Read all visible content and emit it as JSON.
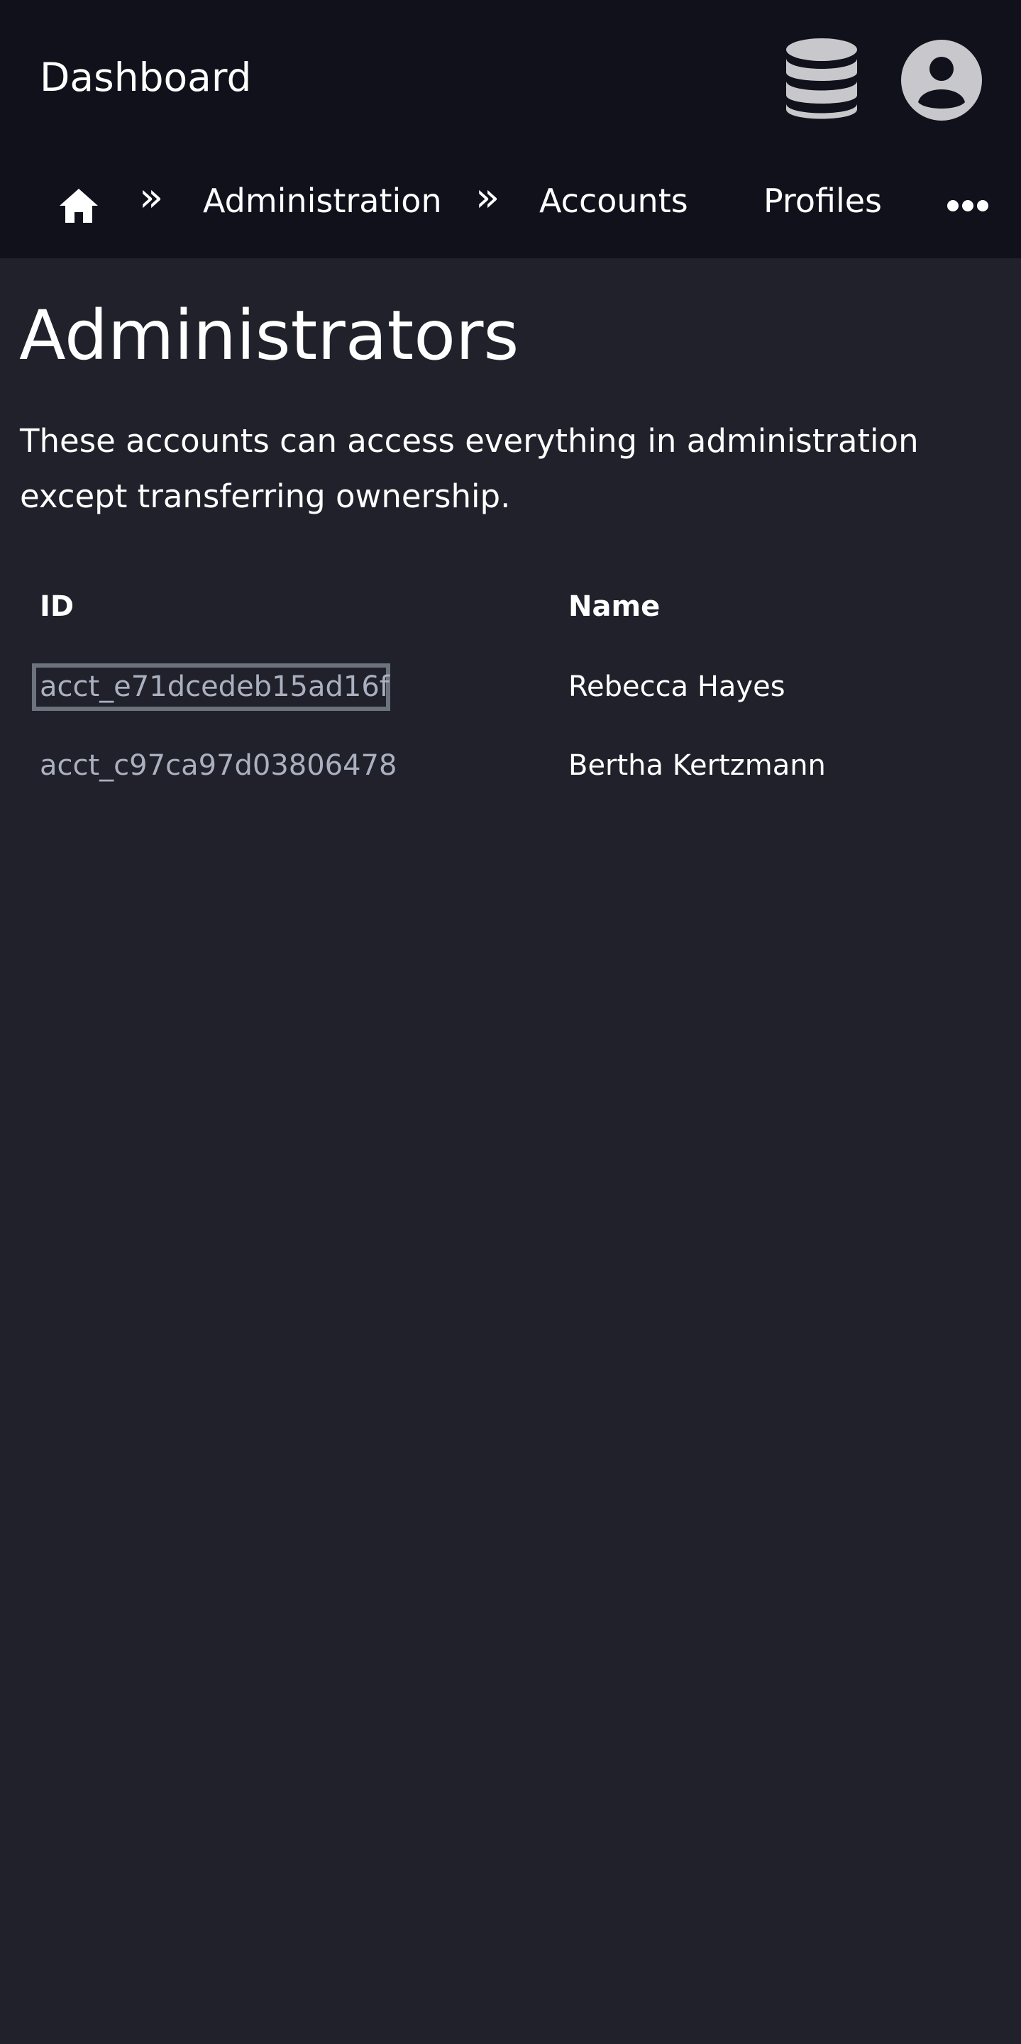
{
  "header": {
    "app_title": "Dashboard",
    "icons": [
      "database-icon",
      "user-circle-icon"
    ]
  },
  "breadcrumb": {
    "home_icon": "home-icon",
    "separator": "»",
    "items": [
      {
        "label": "Administration"
      },
      {
        "label": "Accounts"
      },
      {
        "label": "Profiles"
      }
    ],
    "more_icon": "more-horizontal-icon"
  },
  "page": {
    "title": "Administrators",
    "description": "These accounts can access everything in administration except transferring ownership."
  },
  "table": {
    "columns": [
      "ID",
      "Name"
    ],
    "rows": [
      {
        "id": "acct_e71dcedeb15ad16f",
        "name": "Rebecca Hayes"
      },
      {
        "id": "acct_c97ca97d03806478",
        "name": "Bertha Kertzmann"
      }
    ]
  },
  "colors": {
    "background": "#20212a",
    "topbar": "#10111a",
    "id_link": "#aab0bf",
    "focus_outline": "#6c737d",
    "icon": "#c8c8cc"
  }
}
